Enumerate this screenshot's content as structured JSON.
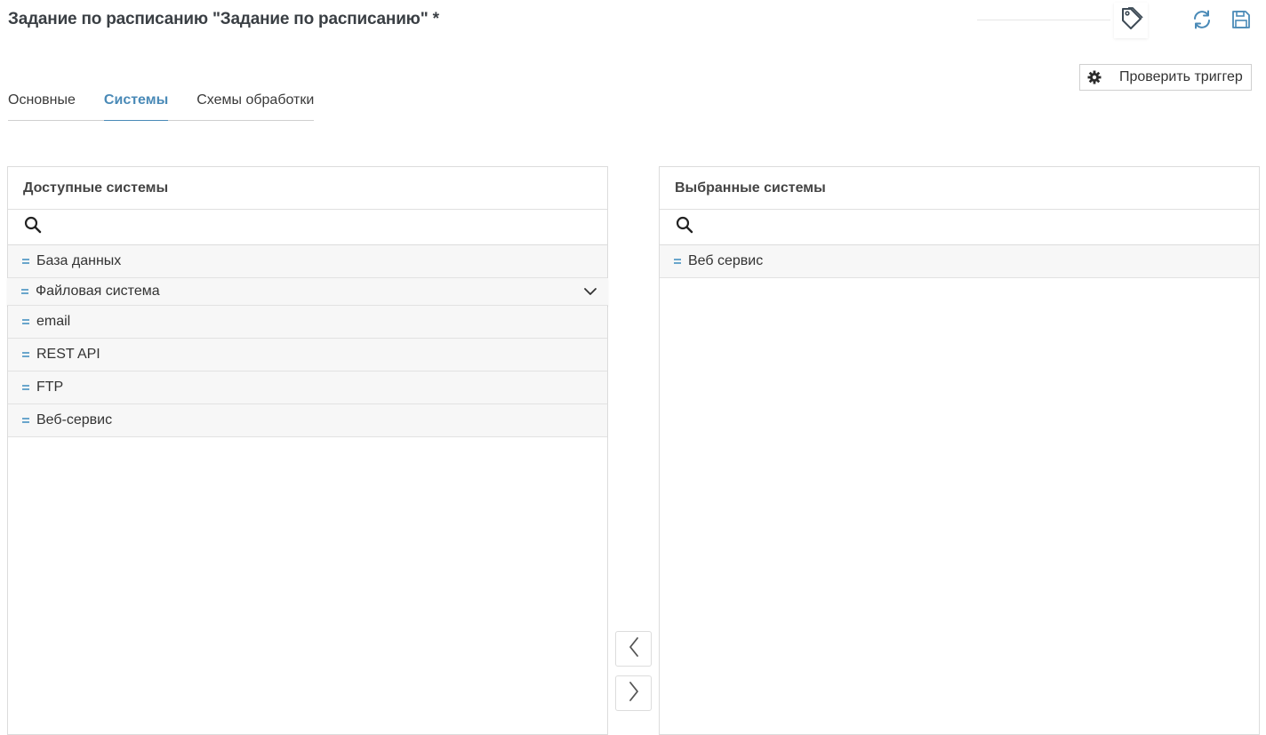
{
  "header": {
    "title": "Задание по расписанию \"Задание по расписанию\" *",
    "check_trigger_label": "Проверить триггер"
  },
  "tabs": [
    {
      "label": "Основные",
      "active": false
    },
    {
      "label": "Системы",
      "active": true
    },
    {
      "label": "Схемы обработки",
      "active": false
    }
  ],
  "available": {
    "title": "Доступные системы",
    "search_placeholder": "",
    "items": [
      "База данных",
      "Файловая система",
      "email",
      "REST API",
      "FTP",
      "Веб-сервис"
    ]
  },
  "selected": {
    "title": "Выбранные системы",
    "search_placeholder": "",
    "items": [
      "Веб сервис"
    ]
  },
  "colors": {
    "accent": "#4a8ab7",
    "handle": "#6aa6cc",
    "item_bg": "#f7f7f7"
  },
  "icons": {
    "tag": "tag-icon",
    "refresh": "refresh-icon",
    "save": "save-icon",
    "gear": "gear-icon",
    "search": "search-icon",
    "move_left": "chevron-left-icon",
    "move_right": "chevron-right-icon",
    "expand": "chevron-down-icon"
  }
}
